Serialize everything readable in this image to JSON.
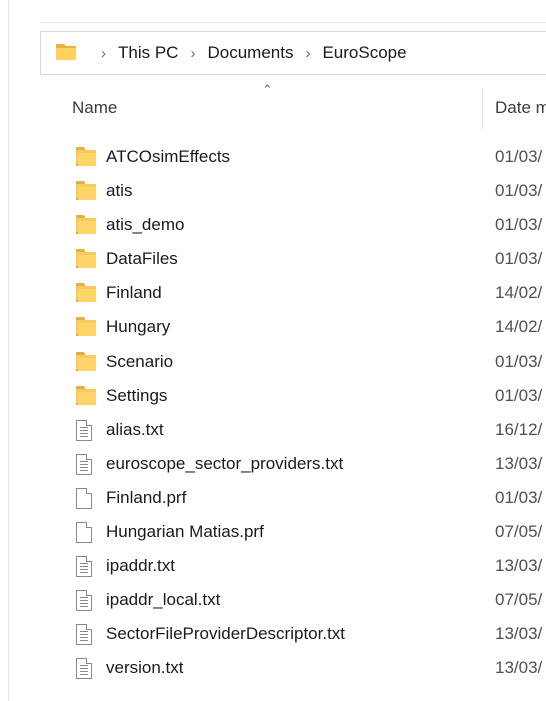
{
  "breadcrumb": {
    "items": [
      "This PC",
      "Documents",
      "EuroScope"
    ]
  },
  "header": {
    "name": "Name",
    "date": "Date m",
    "sort_icon": "chevron-up-icon"
  },
  "files": [
    {
      "name": "ATCOsimEffects",
      "date": "01/03/",
      "type": "folder"
    },
    {
      "name": "atis",
      "date": "01/03/",
      "type": "folder"
    },
    {
      "name": "atis_demo",
      "date": "01/03/",
      "type": "folder"
    },
    {
      "name": "DataFiles",
      "date": "01/03/",
      "type": "folder"
    },
    {
      "name": "Finland",
      "date": "14/02/",
      "type": "folder"
    },
    {
      "name": "Hungary",
      "date": "14/02/",
      "type": "folder"
    },
    {
      "name": "Scenario",
      "date": "01/03/",
      "type": "folder"
    },
    {
      "name": "Settings",
      "date": "01/03/",
      "type": "folder"
    },
    {
      "name": "alias.txt",
      "date": "16/12/",
      "type": "text"
    },
    {
      "name": "euroscope_sector_providers.txt",
      "date": "13/03/",
      "type": "text"
    },
    {
      "name": "Finland.prf",
      "date": "01/03/",
      "type": "blank"
    },
    {
      "name": "Hungarian Matias.prf",
      "date": "07/05/",
      "type": "blank"
    },
    {
      "name": "ipaddr.txt",
      "date": "13/03/",
      "type": "text"
    },
    {
      "name": "ipaddr_local.txt",
      "date": "07/05/",
      "type": "text"
    },
    {
      "name": "SectorFileProviderDescriptor.txt",
      "date": "13/03/",
      "type": "text"
    },
    {
      "name": "version.txt",
      "date": "13/03/",
      "type": "text"
    }
  ]
}
